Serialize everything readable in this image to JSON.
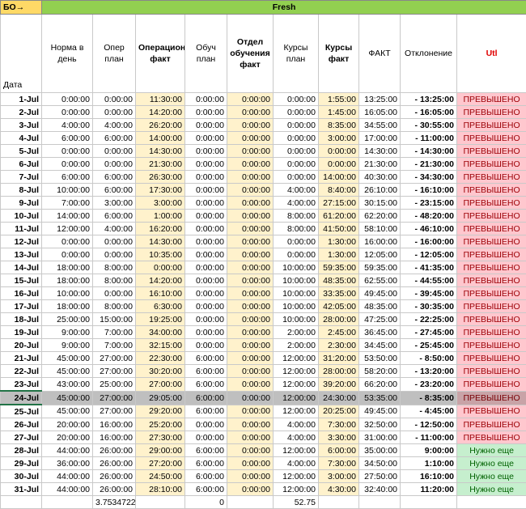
{
  "header": {
    "bo_label": "БО→",
    "fresh_label": "Fresh",
    "columns": {
      "date": "Дата",
      "norm": "Норма в день",
      "oper_plan": "Опер план",
      "oper_fact": "Операционка факт",
      "train_plan": "Обуч план",
      "train_dept_fact": "Отдел обучения факт",
      "courses_plan": "Курсы план",
      "courses_fact": "Курсы факт",
      "fact": "ФАКТ",
      "deviation": "Отклонение",
      "util": "Utl"
    }
  },
  "rows": [
    {
      "date": "1-Jul",
      "norm": "0:00:00",
      "oper_plan": "0:00:00",
      "oper_fact": "11:30:00",
      "train_plan": "0:00:00",
      "train_fact": "0:00:00",
      "courses_plan": "0:00:00",
      "courses_fact": "1:55:00",
      "fact": "13:25:00",
      "deviation": "- 13:25:00",
      "status": "ПРЕВЫШЕНО",
      "status_type": "over"
    },
    {
      "date": "2-Jul",
      "norm": "0:00:00",
      "oper_plan": "0:00:00",
      "oper_fact": "14:20:00",
      "train_plan": "0:00:00",
      "train_fact": "0:00:00",
      "courses_plan": "0:00:00",
      "courses_fact": "1:45:00",
      "fact": "16:05:00",
      "deviation": "- 16:05:00",
      "status": "ПРЕВЫШЕНО",
      "status_type": "over"
    },
    {
      "date": "3-Jul",
      "norm": "4:00:00",
      "oper_plan": "4:00:00",
      "oper_fact": "26:20:00",
      "train_plan": "0:00:00",
      "train_fact": "0:00:00",
      "courses_plan": "0:00:00",
      "courses_fact": "8:35:00",
      "fact": "34:55:00",
      "deviation": "- 30:55:00",
      "status": "ПРЕВЫШЕНО",
      "status_type": "over"
    },
    {
      "date": "4-Jul",
      "norm": "6:00:00",
      "oper_plan": "6:00:00",
      "oper_fact": "14:00:00",
      "train_plan": "0:00:00",
      "train_fact": "0:00:00",
      "courses_plan": "0:00:00",
      "courses_fact": "3:00:00",
      "fact": "17:00:00",
      "deviation": "- 11:00:00",
      "status": "ПРЕВЫШЕНО",
      "status_type": "over"
    },
    {
      "date": "5-Jul",
      "norm": "0:00:00",
      "oper_plan": "0:00:00",
      "oper_fact": "14:30:00",
      "train_plan": "0:00:00",
      "train_fact": "0:00:00",
      "courses_plan": "0:00:00",
      "courses_fact": "0:00:00",
      "fact": "14:30:00",
      "deviation": "- 14:30:00",
      "status": "ПРЕВЫШЕНО",
      "status_type": "over"
    },
    {
      "date": "6-Jul",
      "norm": "0:00:00",
      "oper_plan": "0:00:00",
      "oper_fact": "21:30:00",
      "train_plan": "0:00:00",
      "train_fact": "0:00:00",
      "courses_plan": "0:00:00",
      "courses_fact": "0:00:00",
      "fact": "21:30:00",
      "deviation": "- 21:30:00",
      "status": "ПРЕВЫШЕНО",
      "status_type": "over"
    },
    {
      "date": "7-Jul",
      "norm": "6:00:00",
      "oper_plan": "6:00:00",
      "oper_fact": "26:30:00",
      "train_plan": "0:00:00",
      "train_fact": "0:00:00",
      "courses_plan": "0:00:00",
      "courses_fact": "14:00:00",
      "fact": "40:30:00",
      "deviation": "- 34:30:00",
      "status": "ПРЕВЫШЕНО",
      "status_type": "over"
    },
    {
      "date": "8-Jul",
      "norm": "10:00:00",
      "oper_plan": "6:00:00",
      "oper_fact": "17:30:00",
      "train_plan": "0:00:00",
      "train_fact": "0:00:00",
      "courses_plan": "4:00:00",
      "courses_fact": "8:40:00",
      "fact": "26:10:00",
      "deviation": "- 16:10:00",
      "status": "ПРЕВЫШЕНО",
      "status_type": "over"
    },
    {
      "date": "9-Jul",
      "norm": "7:00:00",
      "oper_plan": "3:00:00",
      "oper_fact": "3:00:00",
      "train_plan": "0:00:00",
      "train_fact": "0:00:00",
      "courses_plan": "4:00:00",
      "courses_fact": "27:15:00",
      "fact": "30:15:00",
      "deviation": "- 23:15:00",
      "status": "ПРЕВЫШЕНО",
      "status_type": "over"
    },
    {
      "date": "10-Jul",
      "norm": "14:00:00",
      "oper_plan": "6:00:00",
      "oper_fact": "1:00:00",
      "train_plan": "0:00:00",
      "train_fact": "0:00:00",
      "courses_plan": "8:00:00",
      "courses_fact": "61:20:00",
      "fact": "62:20:00",
      "deviation": "- 48:20:00",
      "status": "ПРЕВЫШЕНО",
      "status_type": "over"
    },
    {
      "date": "11-Jul",
      "norm": "12:00:00",
      "oper_plan": "4:00:00",
      "oper_fact": "16:20:00",
      "train_plan": "0:00:00",
      "train_fact": "0:00:00",
      "courses_plan": "8:00:00",
      "courses_fact": "41:50:00",
      "fact": "58:10:00",
      "deviation": "- 46:10:00",
      "status": "ПРЕВЫШЕНО",
      "status_type": "over"
    },
    {
      "date": "12-Jul",
      "norm": "0:00:00",
      "oper_plan": "0:00:00",
      "oper_fact": "14:30:00",
      "train_plan": "0:00:00",
      "train_fact": "0:00:00",
      "courses_plan": "0:00:00",
      "courses_fact": "1:30:00",
      "fact": "16:00:00",
      "deviation": "- 16:00:00",
      "status": "ПРЕВЫШЕНО",
      "status_type": "over"
    },
    {
      "date": "13-Jul",
      "norm": "0:00:00",
      "oper_plan": "0:00:00",
      "oper_fact": "10:35:00",
      "train_plan": "0:00:00",
      "train_fact": "0:00:00",
      "courses_plan": "0:00:00",
      "courses_fact": "1:30:00",
      "fact": "12:05:00",
      "deviation": "- 12:05:00",
      "status": "ПРЕВЫШЕНО",
      "status_type": "over"
    },
    {
      "date": "14-Jul",
      "norm": "18:00:00",
      "oper_plan": "8:00:00",
      "oper_fact": "0:00:00",
      "train_plan": "0:00:00",
      "train_fact": "0:00:00",
      "courses_plan": "10:00:00",
      "courses_fact": "59:35:00",
      "fact": "59:35:00",
      "deviation": "- 41:35:00",
      "status": "ПРЕВЫШЕНО",
      "status_type": "over"
    },
    {
      "date": "15-Jul",
      "norm": "18:00:00",
      "oper_plan": "8:00:00",
      "oper_fact": "14:20:00",
      "train_plan": "0:00:00",
      "train_fact": "0:00:00",
      "courses_plan": "10:00:00",
      "courses_fact": "48:35:00",
      "fact": "62:55:00",
      "deviation": "- 44:55:00",
      "status": "ПРЕВЫШЕНО",
      "status_type": "over"
    },
    {
      "date": "16-Jul",
      "norm": "10:00:00",
      "oper_plan": "0:00:00",
      "oper_fact": "16:10:00",
      "train_plan": "0:00:00",
      "train_fact": "0:00:00",
      "courses_plan": "10:00:00",
      "courses_fact": "33:35:00",
      "fact": "49:45:00",
      "deviation": "- 39:45:00",
      "status": "ПРЕВЫШЕНО",
      "status_type": "over"
    },
    {
      "date": "17-Jul",
      "norm": "18:00:00",
      "oper_plan": "8:00:00",
      "oper_fact": "6:30:00",
      "train_plan": "0:00:00",
      "train_fact": "0:00:00",
      "courses_plan": "10:00:00",
      "courses_fact": "42:05:00",
      "fact": "48:35:00",
      "deviation": "- 30:35:00",
      "status": "ПРЕВЫШЕНО",
      "status_type": "over"
    },
    {
      "date": "18-Jul",
      "norm": "25:00:00",
      "oper_plan": "15:00:00",
      "oper_fact": "19:25:00",
      "train_plan": "0:00:00",
      "train_fact": "0:00:00",
      "courses_plan": "10:00:00",
      "courses_fact": "28:00:00",
      "fact": "47:25:00",
      "deviation": "- 22:25:00",
      "status": "ПРЕВЫШЕНО",
      "status_type": "over"
    },
    {
      "date": "19-Jul",
      "norm": "9:00:00",
      "oper_plan": "7:00:00",
      "oper_fact": "34:00:00",
      "train_plan": "0:00:00",
      "train_fact": "0:00:00",
      "courses_plan": "2:00:00",
      "courses_fact": "2:45:00",
      "fact": "36:45:00",
      "deviation": "- 27:45:00",
      "status": "ПРЕВЫШЕНО",
      "status_type": "over"
    },
    {
      "date": "20-Jul",
      "norm": "9:00:00",
      "oper_plan": "7:00:00",
      "oper_fact": "32:15:00",
      "train_plan": "0:00:00",
      "train_fact": "0:00:00",
      "courses_plan": "2:00:00",
      "courses_fact": "2:30:00",
      "fact": "34:45:00",
      "deviation": "- 25:45:00",
      "status": "ПРЕВЫШЕНО",
      "status_type": "over"
    },
    {
      "date": "21-Jul",
      "norm": "45:00:00",
      "oper_plan": "27:00:00",
      "oper_fact": "22:30:00",
      "train_plan": "6:00:00",
      "train_fact": "0:00:00",
      "courses_plan": "12:00:00",
      "courses_fact": "31:20:00",
      "fact": "53:50:00",
      "deviation": "- 8:50:00",
      "status": "ПРЕВЫШЕНО",
      "status_type": "over"
    },
    {
      "date": "22-Jul",
      "norm": "45:00:00",
      "oper_plan": "27:00:00",
      "oper_fact": "30:20:00",
      "train_plan": "6:00:00",
      "train_fact": "0:00:00",
      "courses_plan": "12:00:00",
      "courses_fact": "28:00:00",
      "fact": "58:20:00",
      "deviation": "- 13:20:00",
      "status": "ПРЕВЫШЕНО",
      "status_type": "over"
    },
    {
      "date": "23-Jul",
      "norm": "43:00:00",
      "oper_plan": "25:00:00",
      "oper_fact": "27:00:00",
      "train_plan": "6:00:00",
      "train_fact": "0:00:00",
      "courses_plan": "12:00:00",
      "courses_fact": "39:20:00",
      "fact": "66:20:00",
      "deviation": "- 23:20:00",
      "status": "ПРЕВЫШЕНО",
      "status_type": "over"
    },
    {
      "date": "24-Jul",
      "norm": "45:00:00",
      "oper_plan": "27:00:00",
      "oper_fact": "29:05:00",
      "train_plan": "6:00:00",
      "train_fact": "0:00:00",
      "courses_plan": "12:00:00",
      "courses_fact": "24:30:00",
      "fact": "53:35:00",
      "deviation": "- 8:35:00",
      "status": "ПРЕВЫШЕНО",
      "status_type": "over"
    },
    {
      "date": "25-Jul",
      "norm": "45:00:00",
      "oper_plan": "27:00:00",
      "oper_fact": "29:20:00",
      "train_plan": "6:00:00",
      "train_fact": "0:00:00",
      "courses_plan": "12:00:00",
      "courses_fact": "20:25:00",
      "fact": "49:45:00",
      "deviation": "- 4:45:00",
      "status": "ПРЕВЫШЕНО",
      "status_type": "over"
    },
    {
      "date": "26-Jul",
      "norm": "20:00:00",
      "oper_plan": "16:00:00",
      "oper_fact": "25:20:00",
      "train_plan": "0:00:00",
      "train_fact": "0:00:00",
      "courses_plan": "4:00:00",
      "courses_fact": "7:30:00",
      "fact": "32:50:00",
      "deviation": "- 12:50:00",
      "status": "ПРЕВЫШЕНО",
      "status_type": "over"
    },
    {
      "date": "27-Jul",
      "norm": "20:00:00",
      "oper_plan": "16:00:00",
      "oper_fact": "27:30:00",
      "train_plan": "0:00:00",
      "train_fact": "0:00:00",
      "courses_plan": "4:00:00",
      "courses_fact": "3:30:00",
      "fact": "31:00:00",
      "deviation": "- 11:00:00",
      "status": "ПРЕВЫШЕНО",
      "status_type": "over"
    },
    {
      "date": "28-Jul",
      "norm": "44:00:00",
      "oper_plan": "26:00:00",
      "oper_fact": "29:00:00",
      "train_plan": "6:00:00",
      "train_fact": "0:00:00",
      "courses_plan": "12:00:00",
      "courses_fact": "6:00:00",
      "fact": "35:00:00",
      "deviation": "9:00:00",
      "status": "Нужно еще",
      "status_type": "need"
    },
    {
      "date": "29-Jul",
      "norm": "36:00:00",
      "oper_plan": "26:00:00",
      "oper_fact": "27:20:00",
      "train_plan": "6:00:00",
      "train_fact": "0:00:00",
      "courses_plan": "4:00:00",
      "courses_fact": "7:30:00",
      "fact": "34:50:00",
      "deviation": "1:10:00",
      "status": "Нужно еще",
      "status_type": "need"
    },
    {
      "date": "30-Jul",
      "norm": "44:00:00",
      "oper_plan": "26:00:00",
      "oper_fact": "24:50:00",
      "train_plan": "6:00:00",
      "train_fact": "0:00:00",
      "courses_plan": "12:00:00",
      "courses_fact": "3:00:00",
      "fact": "27:50:00",
      "deviation": "16:10:00",
      "status": "Нужно еще",
      "status_type": "need"
    },
    {
      "date": "31-Jul",
      "norm": "44:00:00",
      "oper_plan": "26:00:00",
      "oper_fact": "28:10:00",
      "train_plan": "6:00:00",
      "train_fact": "0:00:00",
      "courses_plan": "12:00:00",
      "courses_fact": "4:30:00",
      "fact": "32:40:00",
      "deviation": "11:20:00",
      "status": "Нужно еще",
      "status_type": "need"
    }
  ],
  "selected_row": 23,
  "summary": {
    "oper_plan": "3.7534722",
    "train_plan": "0",
    "courses_plan": "52.75"
  }
}
